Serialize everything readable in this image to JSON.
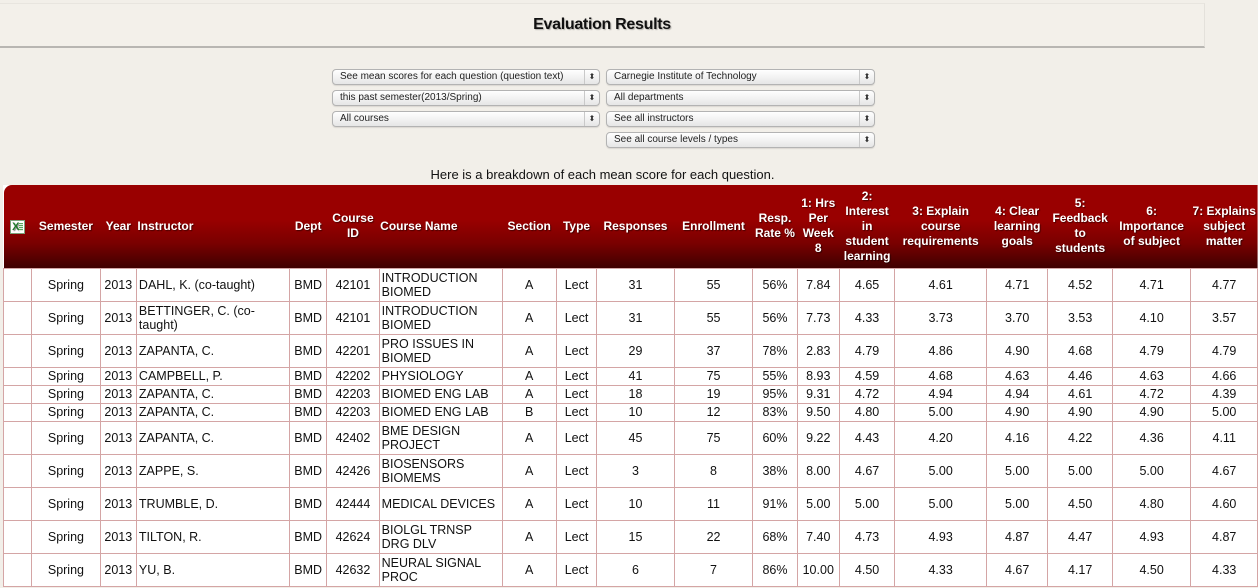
{
  "page": {
    "title": "Evaluation Results",
    "caption": "Here is a breakdown of each mean score for each question."
  },
  "filters": {
    "left": [
      {
        "value": "See mean scores for each question (question text)"
      },
      {
        "value": "this past semester(2013/Spring)"
      },
      {
        "value": "All courses"
      }
    ],
    "right": [
      {
        "value": "Carnegie Institute of Technology"
      },
      {
        "value": "All departments"
      },
      {
        "value": "See all instructors"
      },
      {
        "value": "See all course levels / types"
      }
    ],
    "arrow_glyph": "⬍"
  },
  "table": {
    "export_icon": "excel-icon",
    "columns": [
      "",
      "Semester",
      "Year",
      "Instructor",
      "Dept",
      "Course ID",
      "Course Name",
      "Section",
      "Type",
      "Responses",
      "Enrollment",
      "Resp. Rate %",
      "1: Hrs Per Week 8",
      "2: Interest in student learning",
      "3: Explain course requirements",
      "4: Clear learning goals",
      "5: Feedback to students",
      "6: Importance of subject",
      "7: Explains subject matter"
    ],
    "rows": [
      {
        "semester": "Spring",
        "year": "2013",
        "instructor": "DAHL, K. (co-taught)",
        "dept": "BMD",
        "course_id": "42101",
        "course_name": "INTRODUCTION BIOMED",
        "section": "A",
        "type": "Lect",
        "responses": "31",
        "enrollment": "55",
        "resp_rate": "56%",
        "q1": "7.84",
        "q2": "4.65",
        "q3": "4.61",
        "q4": "4.71",
        "q5": "4.52",
        "q6": "4.71",
        "q7": "4.77"
      },
      {
        "semester": "Spring",
        "year": "2013",
        "instructor": "BETTINGER, C. (co-taught)",
        "dept": "BMD",
        "course_id": "42101",
        "course_name": "INTRODUCTION BIOMED",
        "section": "A",
        "type": "Lect",
        "responses": "31",
        "enrollment": "55",
        "resp_rate": "56%",
        "q1": "7.73",
        "q2": "4.33",
        "q3": "3.73",
        "q4": "3.70",
        "q5": "3.53",
        "q6": "4.10",
        "q7": "3.57"
      },
      {
        "semester": "Spring",
        "year": "2013",
        "instructor": "ZAPANTA, C.",
        "dept": "BMD",
        "course_id": "42201",
        "course_name": "PRO ISSUES IN BIOMED",
        "section": "A",
        "type": "Lect",
        "responses": "29",
        "enrollment": "37",
        "resp_rate": "78%",
        "q1": "2.83",
        "q2": "4.79",
        "q3": "4.86",
        "q4": "4.90",
        "q5": "4.68",
        "q6": "4.79",
        "q7": "4.79"
      },
      {
        "semester": "Spring",
        "year": "2013",
        "instructor": "CAMPBELL, P.",
        "dept": "BMD",
        "course_id": "42202",
        "course_name": "PHYSIOLOGY",
        "section": "A",
        "type": "Lect",
        "responses": "41",
        "enrollment": "75",
        "resp_rate": "55%",
        "q1": "8.93",
        "q2": "4.59",
        "q3": "4.68",
        "q4": "4.63",
        "q5": "4.46",
        "q6": "4.63",
        "q7": "4.66"
      },
      {
        "semester": "Spring",
        "year": "2013",
        "instructor": "ZAPANTA, C.",
        "dept": "BMD",
        "course_id": "42203",
        "course_name": "BIOMED ENG LAB",
        "section": "A",
        "type": "Lect",
        "responses": "18",
        "enrollment": "19",
        "resp_rate": "95%",
        "q1": "9.31",
        "q2": "4.72",
        "q3": "4.94",
        "q4": "4.94",
        "q5": "4.61",
        "q6": "4.72",
        "q7": "4.39"
      },
      {
        "semester": "Spring",
        "year": "2013",
        "instructor": "ZAPANTA, C.",
        "dept": "BMD",
        "course_id": "42203",
        "course_name": "BIOMED ENG LAB",
        "section": "B",
        "type": "Lect",
        "responses": "10",
        "enrollment": "12",
        "resp_rate": "83%",
        "q1": "9.50",
        "q2": "4.80",
        "q3": "5.00",
        "q4": "4.90",
        "q5": "4.90",
        "q6": "4.90",
        "q7": "5.00"
      },
      {
        "semester": "Spring",
        "year": "2013",
        "instructor": "ZAPANTA, C.",
        "dept": "BMD",
        "course_id": "42402",
        "course_name": "BME DESIGN PROJECT",
        "section": "A",
        "type": "Lect",
        "responses": "45",
        "enrollment": "75",
        "resp_rate": "60%",
        "q1": "9.22",
        "q2": "4.43",
        "q3": "4.20",
        "q4": "4.16",
        "q5": "4.22",
        "q6": "4.36",
        "q7": "4.11"
      },
      {
        "semester": "Spring",
        "year": "2013",
        "instructor": "ZAPPE, S.",
        "dept": "BMD",
        "course_id": "42426",
        "course_name": "BIOSENSORS BIOMEMS",
        "section": "A",
        "type": "Lect",
        "responses": "3",
        "enrollment": "8",
        "resp_rate": "38%",
        "q1": "8.00",
        "q2": "4.67",
        "q3": "5.00",
        "q4": "5.00",
        "q5": "5.00",
        "q6": "5.00",
        "q7": "4.67"
      },
      {
        "semester": "Spring",
        "year": "2013",
        "instructor": "TRUMBLE, D.",
        "dept": "BMD",
        "course_id": "42444",
        "course_name": "MEDICAL DEVICES",
        "section": "A",
        "type": "Lect",
        "responses": "10",
        "enrollment": "11",
        "resp_rate": "91%",
        "q1": "5.00",
        "q2": "5.00",
        "q3": "5.00",
        "q4": "5.00",
        "q5": "4.50",
        "q6": "4.80",
        "q7": "4.60"
      },
      {
        "semester": "Spring",
        "year": "2013",
        "instructor": "TILTON, R.",
        "dept": "BMD",
        "course_id": "42624",
        "course_name": "BIOLGL TRNSP DRG DLV",
        "section": "A",
        "type": "Lect",
        "responses": "15",
        "enrollment": "22",
        "resp_rate": "68%",
        "q1": "7.40",
        "q2": "4.73",
        "q3": "4.93",
        "q4": "4.87",
        "q5": "4.47",
        "q6": "4.93",
        "q7": "4.87"
      },
      {
        "semester": "Spring",
        "year": "2013",
        "instructor": "YU, B.",
        "dept": "BMD",
        "course_id": "42632",
        "course_name": "NEURAL SIGNAL PROC",
        "section": "A",
        "type": "Lect",
        "responses": "6",
        "enrollment": "7",
        "resp_rate": "86%",
        "q1": "10.00",
        "q2": "4.50",
        "q3": "4.33",
        "q4": "4.67",
        "q5": "4.17",
        "q6": "4.50",
        "q7": "4.33"
      }
    ]
  }
}
